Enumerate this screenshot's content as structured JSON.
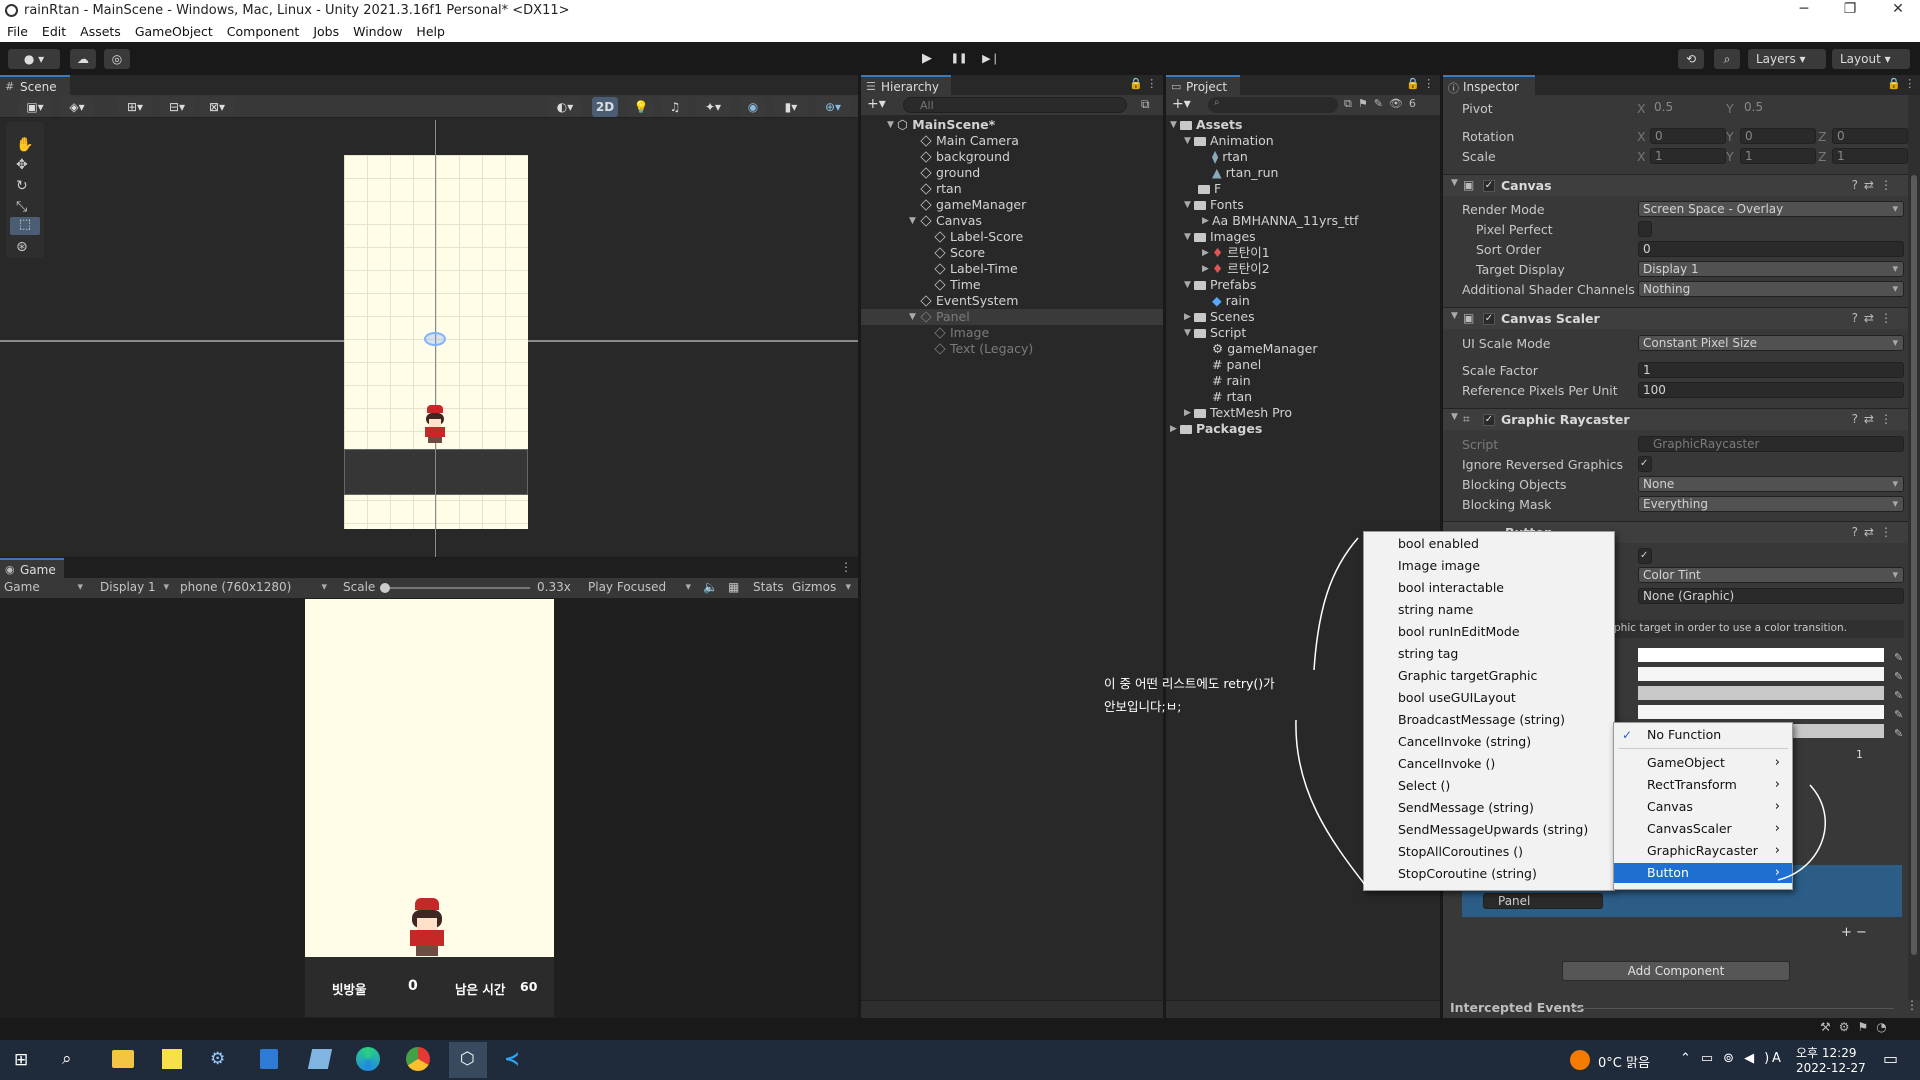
{
  "window": {
    "title": "rainRtan - MainScene - Windows, Mac, Linux - Unity 2021.3.16f1 Personal* <DX11>",
    "minimize": "─",
    "maximize": "❐",
    "close": "✕"
  },
  "menu": [
    "File",
    "Edit",
    "Assets",
    "GameObject",
    "Component",
    "Jobs",
    "Window",
    "Help"
  ],
  "toolbar": {
    "layers_label": "Layers",
    "layout_label": "Layout",
    "play": "▶",
    "pause": "❚❚",
    "step": "▶❘"
  },
  "scene": {
    "tab": "Scene",
    "mode_2d": "2D"
  },
  "game": {
    "tab": "Game",
    "view_select": "Game",
    "display": "Display 1",
    "resolution": "phone (760x1280)",
    "scale_label": "Scale",
    "scale_value": "0.33x",
    "play_focused": "Play Focused",
    "stats": "Stats",
    "gizmos": "Gizmos",
    "hud": {
      "score_label": "빗방울",
      "score": "0",
      "time_label": "남은 시간",
      "time": "60"
    }
  },
  "hierarchy": {
    "tab": "Hierarchy",
    "search_placeholder": "All",
    "scene": "MainScene*",
    "items": [
      "Main Camera",
      "background",
      "ground",
      "rtan",
      "gameManager",
      "Canvas",
      "Label-Score",
      "Score",
      "Label-Time",
      "Time",
      "EventSystem",
      "Panel",
      "Image",
      "Text (Legacy)"
    ]
  },
  "project": {
    "tab": "Project",
    "root": "Assets",
    "items": [
      "Animation",
      "rtan",
      "rtan_run",
      "F",
      "Fonts",
      "BMHANNA_11yrs_ttf",
      "Images",
      "르탄이1",
      "르탄이2",
      "Prefabs",
      "rain",
      "Scenes",
      "Script",
      "gameManager",
      "panel",
      "rain",
      "rtan",
      "TextMesh Pro",
      "Packages"
    ],
    "font_prefix": "Aa"
  },
  "inspector": {
    "tab": "Inspector",
    "transform": {
      "pivot_label": "Pivot",
      "pivot_x": "0.5",
      "pivot_y": "0.5",
      "rotation_label": "Rotation",
      "rot": [
        "0",
        "0",
        "0"
      ],
      "scale_label": "Scale",
      "scale": [
        "1",
        "1",
        "1"
      ],
      "x": "X",
      "y": "Y",
      "z": "Z"
    },
    "canvas": {
      "name": "Canvas",
      "render_mode_label": "Render Mode",
      "render_mode": "Screen Space - Overlay",
      "pixel_perfect_label": "Pixel Perfect",
      "sort_order_label": "Sort Order",
      "sort_order": "0",
      "target_display_label": "Target Display",
      "target_display": "Display 1",
      "shader_label": "Additional Shader Channels",
      "shader": "Nothing"
    },
    "scaler": {
      "name": "Canvas Scaler",
      "mode_label": "UI Scale Mode",
      "mode": "Constant Pixel Size",
      "factor_label": "Scale Factor",
      "factor": "1",
      "ref_label": "Reference Pixels Per Unit",
      "ref": "100"
    },
    "raycaster": {
      "name": "Graphic Raycaster",
      "script_label": "Script",
      "script": "GraphicRaycaster",
      "ignore_label": "Ignore Reversed Graphics",
      "blocking_label": "Blocking Objects",
      "blocking": "None",
      "mask_label": "Blocking Mask",
      "mask": "Everything"
    },
    "button": {
      "name": "Button",
      "transition": "Color Tint",
      "target": "None (Graphic)",
      "hint": "phic target in order to use a color transition.",
      "fade": "1",
      "panel_ref": "Panel"
    },
    "add_component": "Add Component",
    "intercepted": "Intercepted Events"
  },
  "context_menu": {
    "items": [
      "bool enabled",
      "Image image",
      "bool interactable",
      "string name",
      "bool runInEditMode",
      "string tag",
      "Graphic targetGraphic",
      "bool useGUILayout",
      "BroadcastMessage (string)",
      "CancelInvoke (string)",
      "CancelInvoke ()",
      "Select ()",
      "SendMessage (string)",
      "SendMessageUpwards (string)",
      "StopAllCoroutines ()",
      "StopCoroutine (string)"
    ]
  },
  "function_menu": {
    "items": [
      "No Function",
      "GameObject",
      "RectTransform",
      "Canvas",
      "CanvasScaler",
      "GraphicRaycaster",
      "Button"
    ],
    "check": "✓"
  },
  "annotation": {
    "line1": "이 중 어떤 리스트에도 retry()가",
    "line2": "안보입니다;ㅂ;"
  },
  "taskbar": {
    "weather": "0°C 맑음",
    "time": "오후 12:29",
    "date": "2022-12-27",
    "ime": "A"
  },
  "colors": {
    "accent": "#3a79bb",
    "selection": "#2c5d87",
    "scene_bg": "#fffde7"
  }
}
